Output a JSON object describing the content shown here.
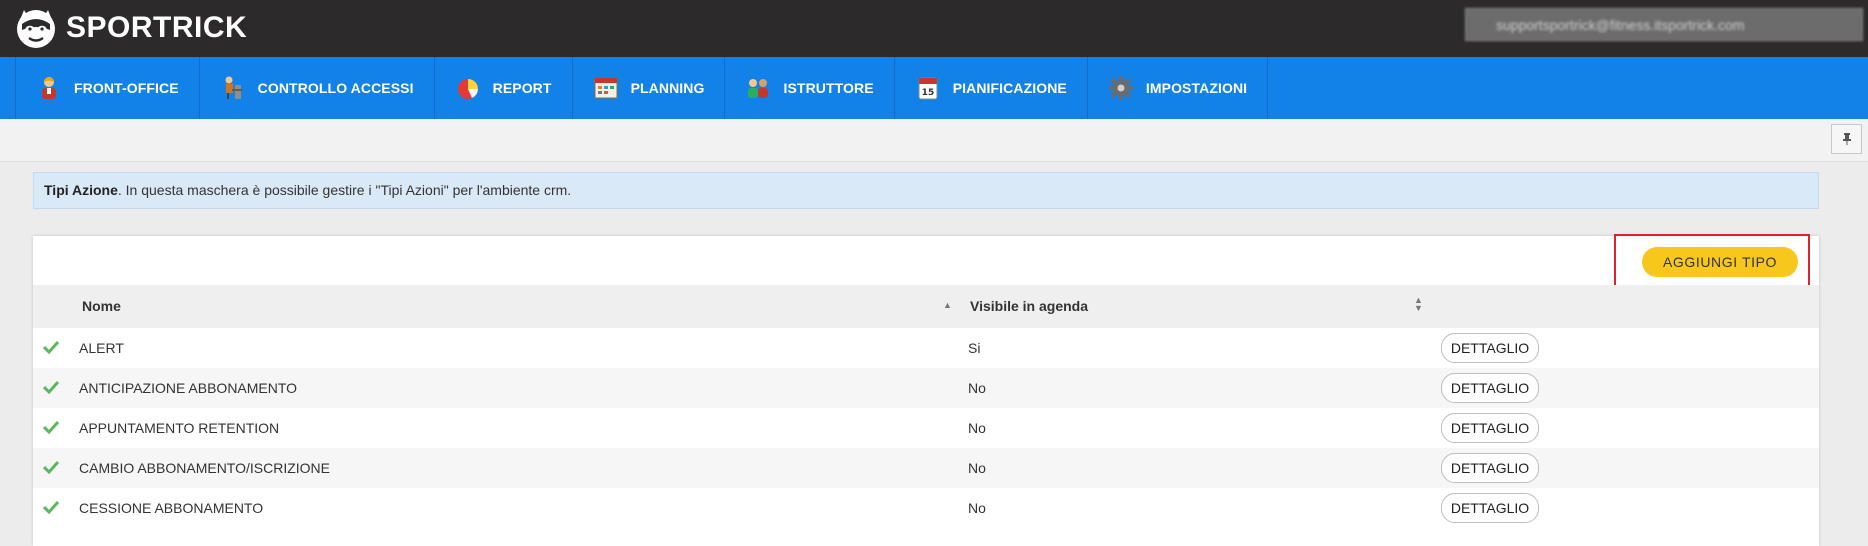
{
  "app": {
    "brand": "SPORTRICK",
    "user_email": "supportsportrick@fitness.itsportrick.com"
  },
  "nav": {
    "items": [
      {
        "label": "FRONT-OFFICE",
        "icon": "person-icon"
      },
      {
        "label": "CONTROLLO ACCESSI",
        "icon": "turnstile-icon"
      },
      {
        "label": "REPORT",
        "icon": "pie-chart-icon"
      },
      {
        "label": "PLANNING",
        "icon": "calendar-grid-icon"
      },
      {
        "label": "ISTRUTTORE",
        "icon": "instructor-icon"
      },
      {
        "label": "PIANIFICAZIONE",
        "icon": "calendar-15-icon"
      },
      {
        "label": "IMPOSTAZIONI",
        "icon": "gear-icon"
      }
    ],
    "active": "IMPOSTAZIONI"
  },
  "info": {
    "title": "Tipi Azione",
    "text": ". In questa maschera è possibile gestire i \"Tipi Azioni\" per l'ambiente crm."
  },
  "toolbar": {
    "add_label": "AGGIUNGI TIPO"
  },
  "table": {
    "columns": [
      "Nome",
      "Visibile in agenda"
    ],
    "detail_label": "DETTAGLIO",
    "rows": [
      {
        "name": "ALERT",
        "visible": "Si"
      },
      {
        "name": "ANTICIPAZIONE ABBONAMENTO",
        "visible": "No"
      },
      {
        "name": "APPUNTAMENTO RETENTION",
        "visible": "No"
      },
      {
        "name": "CAMBIO ABBONAMENTO/ISCRIZIONE",
        "visible": "No"
      },
      {
        "name": "CESSIONE ABBONAMENTO",
        "visible": "No"
      }
    ]
  },
  "colors": {
    "topbar": "#2c2a2a",
    "nav": "#1382e8",
    "accent": "#f7c81b",
    "highlight": "#e0232a",
    "check": "#5cb85c"
  }
}
